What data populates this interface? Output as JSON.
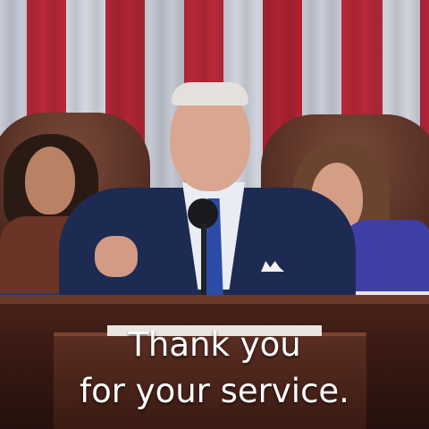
{
  "image": {
    "caption_lines": [
      "Thank you",
      "for your service."
    ]
  }
}
